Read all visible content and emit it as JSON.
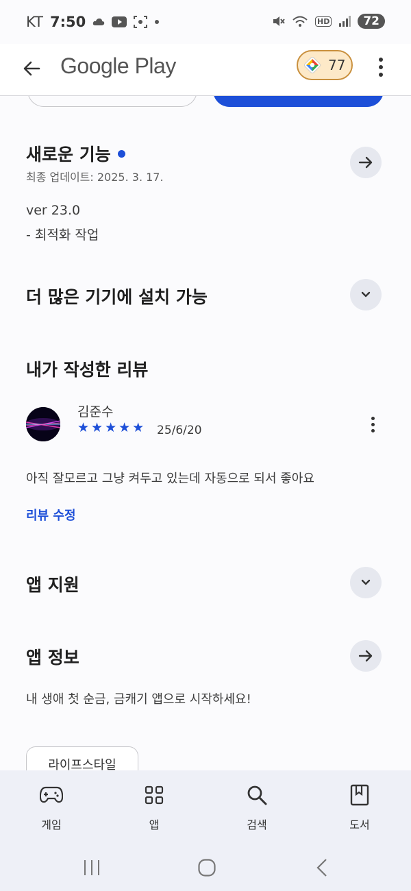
{
  "status_bar": {
    "carrier": "KT",
    "time": "7:50",
    "battery": "72",
    "hd_label": "HD"
  },
  "app_bar": {
    "title": "Google Play",
    "points": "77"
  },
  "whats_new": {
    "title": "새로운 기능",
    "updated": "최종 업데이트: 2025. 3. 17.",
    "version": "ver 23.0",
    "note": "- 최적화 작업"
  },
  "install_more": {
    "title": "더 많은 기기에 설치 가능"
  },
  "my_review": {
    "title": "내가 작성한 리뷰",
    "author": "김준수",
    "rating": 5,
    "stars": "★★★★★",
    "date": "25/6/20",
    "text": "아직 잘모르고 그냥 켜두고 있는데 자동으로 되서 좋아요",
    "edit_label": "리뷰 수정"
  },
  "app_support": {
    "title": "앱 지원"
  },
  "app_info": {
    "title": "앱 정보",
    "description": "내 생애 첫 순금, 금캐기 앱으로 시작하세요!"
  },
  "category_chip": "라이프스타일",
  "bottom_nav": {
    "games": "게임",
    "apps": "앱",
    "search": "검색",
    "books": "도서"
  },
  "colors": {
    "accent": "#1d4fd8",
    "pill_bg": "#fde9c8",
    "pill_border": "#c9903e",
    "nav_bg": "#eef0f7"
  }
}
